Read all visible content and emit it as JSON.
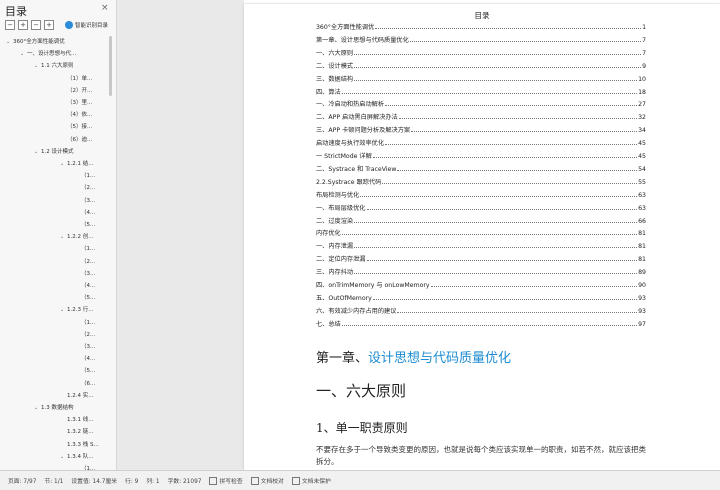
{
  "nav": {
    "title": "目录",
    "close_glyph": "×",
    "tool_icons": [
      "collapse-all-icon",
      "expand-all-icon",
      "remove-icon",
      "add-icon"
    ],
    "smart_toc_label": "智能识别目录",
    "items": [
      {
        "label": "360°全方面性能调优",
        "depth": 0,
        "caret": "v"
      },
      {
        "label": "一、设计思想与代...",
        "depth": 1,
        "caret": "v"
      },
      {
        "label": "1.1 六大原则",
        "depth": 2,
        "caret": "v"
      },
      {
        "label": "（1）单...",
        "depth": 3,
        "caret": ""
      },
      {
        "label": "（2）开...",
        "depth": 3,
        "caret": ""
      },
      {
        "label": "（3）里...",
        "depth": 3,
        "caret": ""
      },
      {
        "label": "（4）依...",
        "depth": 3,
        "caret": ""
      },
      {
        "label": "（5）接...",
        "depth": 3,
        "caret": ""
      },
      {
        "label": "（6）迪...",
        "depth": 3,
        "caret": ""
      },
      {
        "label": "1.2 设计模式",
        "depth": 2,
        "caret": "v"
      },
      {
        "label": "1.2.1 结...",
        "depth": 3,
        "caret": "v"
      },
      {
        "label": "（1...",
        "depth": 4,
        "caret": ""
      },
      {
        "label": "（2...",
        "depth": 4,
        "caret": ""
      },
      {
        "label": "（3...",
        "depth": 4,
        "caret": ""
      },
      {
        "label": "（4...",
        "depth": 4,
        "caret": ""
      },
      {
        "label": "（5...",
        "depth": 4,
        "caret": ""
      },
      {
        "label": "1.2.2 创...",
        "depth": 3,
        "caret": "v"
      },
      {
        "label": "（1...",
        "depth": 4,
        "caret": ""
      },
      {
        "label": "（2...",
        "depth": 4,
        "caret": ""
      },
      {
        "label": "（3...",
        "depth": 4,
        "caret": ""
      },
      {
        "label": "（4...",
        "depth": 4,
        "caret": ""
      },
      {
        "label": "（5...",
        "depth": 4,
        "caret": ""
      },
      {
        "label": "1.2.3 行...",
        "depth": 3,
        "caret": "v"
      },
      {
        "label": "（1...",
        "depth": 4,
        "caret": ""
      },
      {
        "label": "（2...",
        "depth": 4,
        "caret": ""
      },
      {
        "label": "（3...",
        "depth": 4,
        "caret": ""
      },
      {
        "label": "（4...",
        "depth": 4,
        "caret": ""
      },
      {
        "label": "（5...",
        "depth": 4,
        "caret": ""
      },
      {
        "label": "（6...",
        "depth": 4,
        "caret": ""
      },
      {
        "label": "1.2.4 实...",
        "depth": 3,
        "caret": ""
      },
      {
        "label": "1.3 数据结构",
        "depth": 2,
        "caret": "v"
      },
      {
        "label": "1.3.1 线...",
        "depth": 3,
        "caret": ""
      },
      {
        "label": "1.3.2 链...",
        "depth": 3,
        "caret": ""
      },
      {
        "label": "1.3.3 栈 S...",
        "depth": 3,
        "caret": ""
      },
      {
        "label": "1.3.4 队...",
        "depth": 3,
        "caret": "v"
      },
      {
        "label": "（1...",
        "depth": 4,
        "caret": ""
      }
    ]
  },
  "document": {
    "toc_heading": "目录",
    "toc": [
      {
        "label": "360°全方面性能调优",
        "page": "1"
      },
      {
        "label": "第一章、设计思想与代码质量优化",
        "page": "7"
      },
      {
        "label": "一、六大原则",
        "page": "7"
      },
      {
        "label": "二、设计模式",
        "page": "9"
      },
      {
        "label": "三、数据结构",
        "page": "10"
      },
      {
        "label": "四、算法",
        "page": "18"
      },
      {
        "label": "一、冷启动和热启动解析",
        "page": "27"
      },
      {
        "label": "二、APP 启动黑白屏解决办法",
        "page": "32"
      },
      {
        "label": "三、APP 卡顿问题分析及解决方案",
        "page": "34"
      },
      {
        "label": "启动速度与执行效率优化",
        "page": "45"
      },
      {
        "label": "一 StrictMode 详解",
        "page": "45"
      },
      {
        "label": "二、Systrace 和 TraceView",
        "page": "54"
      },
      {
        "label": "2.2.Systrace 跟踪代码",
        "page": "55"
      },
      {
        "label": "布局检测与优化",
        "page": "63"
      },
      {
        "label": "一、布局层级优化",
        "page": "63"
      },
      {
        "label": "二、过度渲染",
        "page": "66"
      },
      {
        "label": "内存优化",
        "page": "81"
      },
      {
        "label": "一、内存泄漏",
        "page": "81"
      },
      {
        "label": "二、定位内存泄漏",
        "page": "81"
      },
      {
        "label": "三、内存抖动",
        "page": "89"
      },
      {
        "label": "四、onTrimMemory 与 onLowMemory",
        "page": "90"
      },
      {
        "label": "五、OutOfMemory",
        "page": "93"
      },
      {
        "label": "六、有效减少内存占用的建议",
        "page": "93"
      },
      {
        "label": "七、总结",
        "page": "97"
      }
    ],
    "chapter_prefix": "第一章、",
    "chapter_title": "设计思想与代码质量优化",
    "section_title": "一、六大原则",
    "subsection_title": "1、单一职责原则",
    "paragraph": "不要存在多于一个导致类变更的原因，也就是说每个类应该实现单一的职责，如若不然，就应该把类拆分。",
    "accent_color": "#1e8cd2"
  },
  "statusbar": {
    "page": "页面: 7/97",
    "section": "节: 1/1",
    "setting": "设置值: 14.7厘米",
    "row": "行: 9",
    "col": "列: 1",
    "words": "字数: 21097",
    "spell": "拼写检查",
    "proof": "文档校对",
    "protect": "文档未保护"
  }
}
